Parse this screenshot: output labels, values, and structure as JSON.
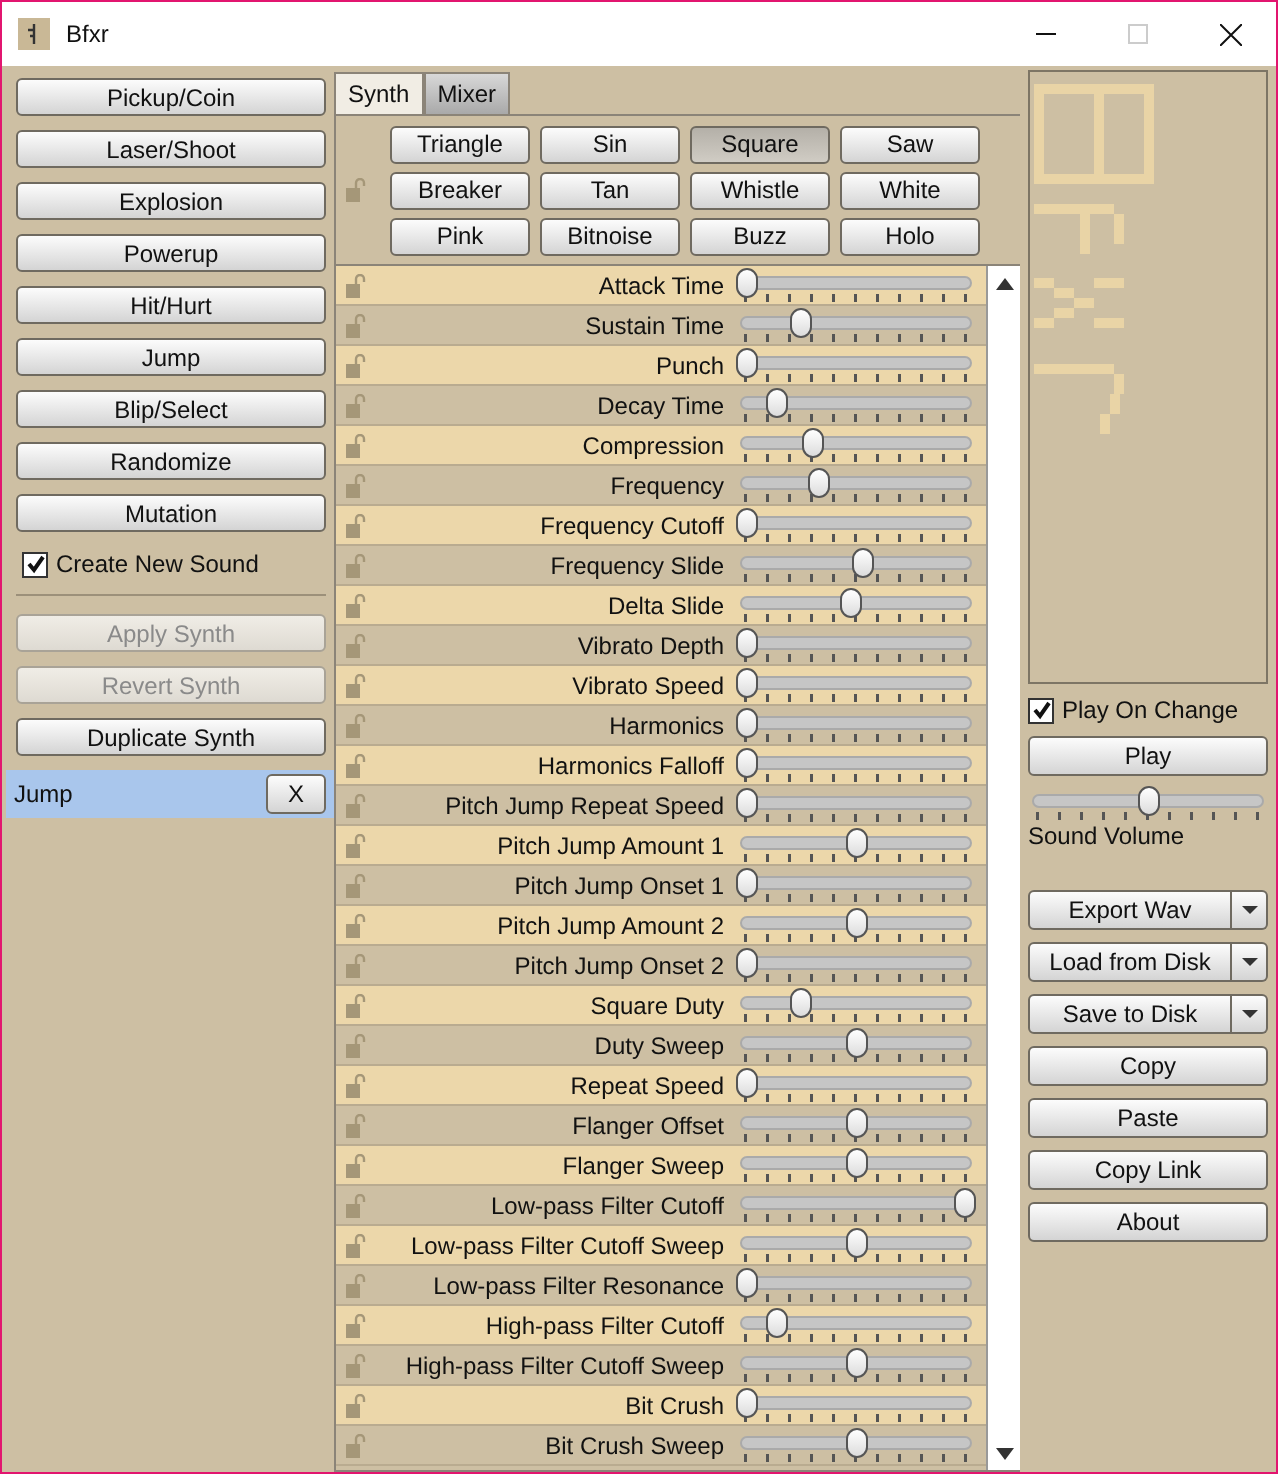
{
  "window": {
    "title": "Bfxr"
  },
  "presets": [
    {
      "label": "Pickup/Coin"
    },
    {
      "label": "Laser/Shoot"
    },
    {
      "label": "Explosion"
    },
    {
      "label": "Powerup"
    },
    {
      "label": "Hit/Hurt"
    },
    {
      "label": "Jump"
    },
    {
      "label": "Blip/Select"
    },
    {
      "label": "Randomize"
    },
    {
      "label": "Mutation"
    }
  ],
  "create_new_sound": {
    "label": "Create New Sound",
    "checked": true
  },
  "synth_actions": [
    {
      "label": "Apply Synth",
      "disabled": true
    },
    {
      "label": "Revert Synth",
      "disabled": true
    },
    {
      "label": "Duplicate Synth",
      "disabled": false
    }
  ],
  "sounds": [
    {
      "name": "Jump",
      "selected": true,
      "delete_label": "X"
    }
  ],
  "tabs": [
    {
      "label": "Synth",
      "selected": true
    },
    {
      "label": "Mixer",
      "selected": false
    }
  ],
  "waveforms": [
    {
      "label": "Triangle",
      "selected": false
    },
    {
      "label": "Sin",
      "selected": false
    },
    {
      "label": "Square",
      "selected": true
    },
    {
      "label": "Saw",
      "selected": false
    },
    {
      "label": "Breaker",
      "selected": false
    },
    {
      "label": "Tan",
      "selected": false
    },
    {
      "label": "Whistle",
      "selected": false
    },
    {
      "label": "White",
      "selected": false
    },
    {
      "label": "Pink",
      "selected": false
    },
    {
      "label": "Bitnoise",
      "selected": false
    },
    {
      "label": "Buzz",
      "selected": false
    },
    {
      "label": "Holo",
      "selected": false
    }
  ],
  "parameters": [
    {
      "name": "Attack Time",
      "level": 0
    },
    {
      "name": "Sustain Time",
      "level": 0.25
    },
    {
      "name": "Punch",
      "level": 0
    },
    {
      "name": "Decay Time",
      "level": 0.14
    },
    {
      "name": "Compression",
      "level": 0.3
    },
    {
      "name": "Frequency",
      "level": 0.33
    },
    {
      "name": "Frequency Cutoff",
      "level": 0
    },
    {
      "name": "Frequency Slide",
      "level": 0.53
    },
    {
      "name": "Delta Slide",
      "level": 0.48
    },
    {
      "name": "Vibrato Depth",
      "level": 0
    },
    {
      "name": "Vibrato Speed",
      "level": 0
    },
    {
      "name": "Harmonics",
      "level": 0
    },
    {
      "name": "Harmonics Falloff",
      "level": 0
    },
    {
      "name": "Pitch Jump Repeat Speed",
      "level": 0
    },
    {
      "name": "Pitch Jump Amount 1",
      "level": 0.5
    },
    {
      "name": "Pitch Jump Onset 1",
      "level": 0
    },
    {
      "name": "Pitch Jump Amount 2",
      "level": 0.5
    },
    {
      "name": "Pitch Jump Onset 2",
      "level": 0
    },
    {
      "name": "Square Duty",
      "level": 0.25
    },
    {
      "name": "Duty Sweep",
      "level": 0.5
    },
    {
      "name": "Repeat Speed",
      "level": 0
    },
    {
      "name": "Flanger Offset",
      "level": 0.5
    },
    {
      "name": "Flanger Sweep",
      "level": 0.5
    },
    {
      "name": "Low-pass Filter Cutoff",
      "level": 1
    },
    {
      "name": "Low-pass Filter Cutoff Sweep",
      "level": 0.5
    },
    {
      "name": "Low-pass Filter Resonance",
      "level": 0
    },
    {
      "name": "High-pass Filter Cutoff",
      "level": 0.14
    },
    {
      "name": "High-pass Filter Cutoff Sweep",
      "level": 0.5
    },
    {
      "name": "Bit Crush",
      "level": 0
    },
    {
      "name": "Bit Crush Sweep",
      "level": 0.5
    }
  ],
  "play_on_change": {
    "label": "Play On Change",
    "checked": true
  },
  "play_button": "Play",
  "volume": {
    "label": "Sound Volume",
    "level": 0.5
  },
  "file_actions": [
    {
      "label": "Export Wav",
      "kind": "split"
    },
    {
      "label": "Load from Disk",
      "kind": "split"
    },
    {
      "label": "Save to Disk",
      "kind": "split"
    },
    {
      "label": "Copy",
      "kind": "plain"
    },
    {
      "label": "Paste",
      "kind": "plain"
    },
    {
      "label": "Copy Link",
      "kind": "plain"
    },
    {
      "label": "About",
      "kind": "plain"
    }
  ]
}
